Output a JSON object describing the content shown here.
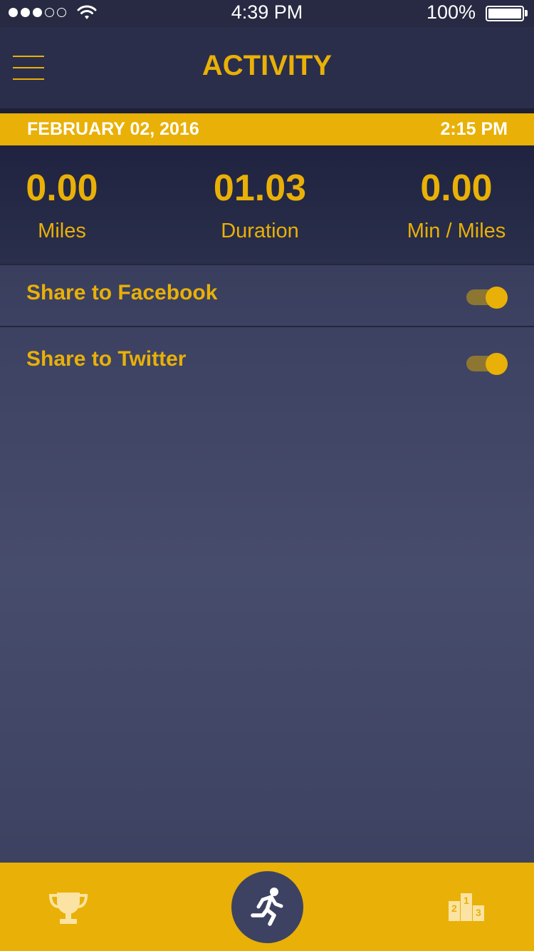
{
  "status_bar": {
    "time": "4:39 PM",
    "battery": "100%",
    "signal_bars_filled": 3,
    "signal_bars_total": 5
  },
  "nav": {
    "title": "ACTIVITY",
    "menu_icon": "hamburger-icon"
  },
  "date_bar": {
    "date": "FEBRUARY 02, 2016",
    "time": "2:15 PM"
  },
  "stats": [
    {
      "value": "0.00",
      "label": "Miles"
    },
    {
      "value": "01.03",
      "label": "Duration"
    },
    {
      "value": "0.00",
      "label": "Min / Miles"
    }
  ],
  "share": {
    "facebook": {
      "label": "Share to Facebook",
      "enabled": true
    },
    "twitter": {
      "label": "Share to Twitter",
      "enabled": true
    }
  },
  "tab_bar": {
    "items": [
      {
        "icon": "trophy-icon"
      },
      {
        "icon": "running-icon",
        "active": true
      },
      {
        "icon": "leaderboard-podium-icon",
        "ranks": [
          "2",
          "1",
          "3"
        ]
      }
    ]
  },
  "colors": {
    "accent": "#e9b007",
    "background": "#3d4262",
    "header": "#2a2e4b"
  }
}
